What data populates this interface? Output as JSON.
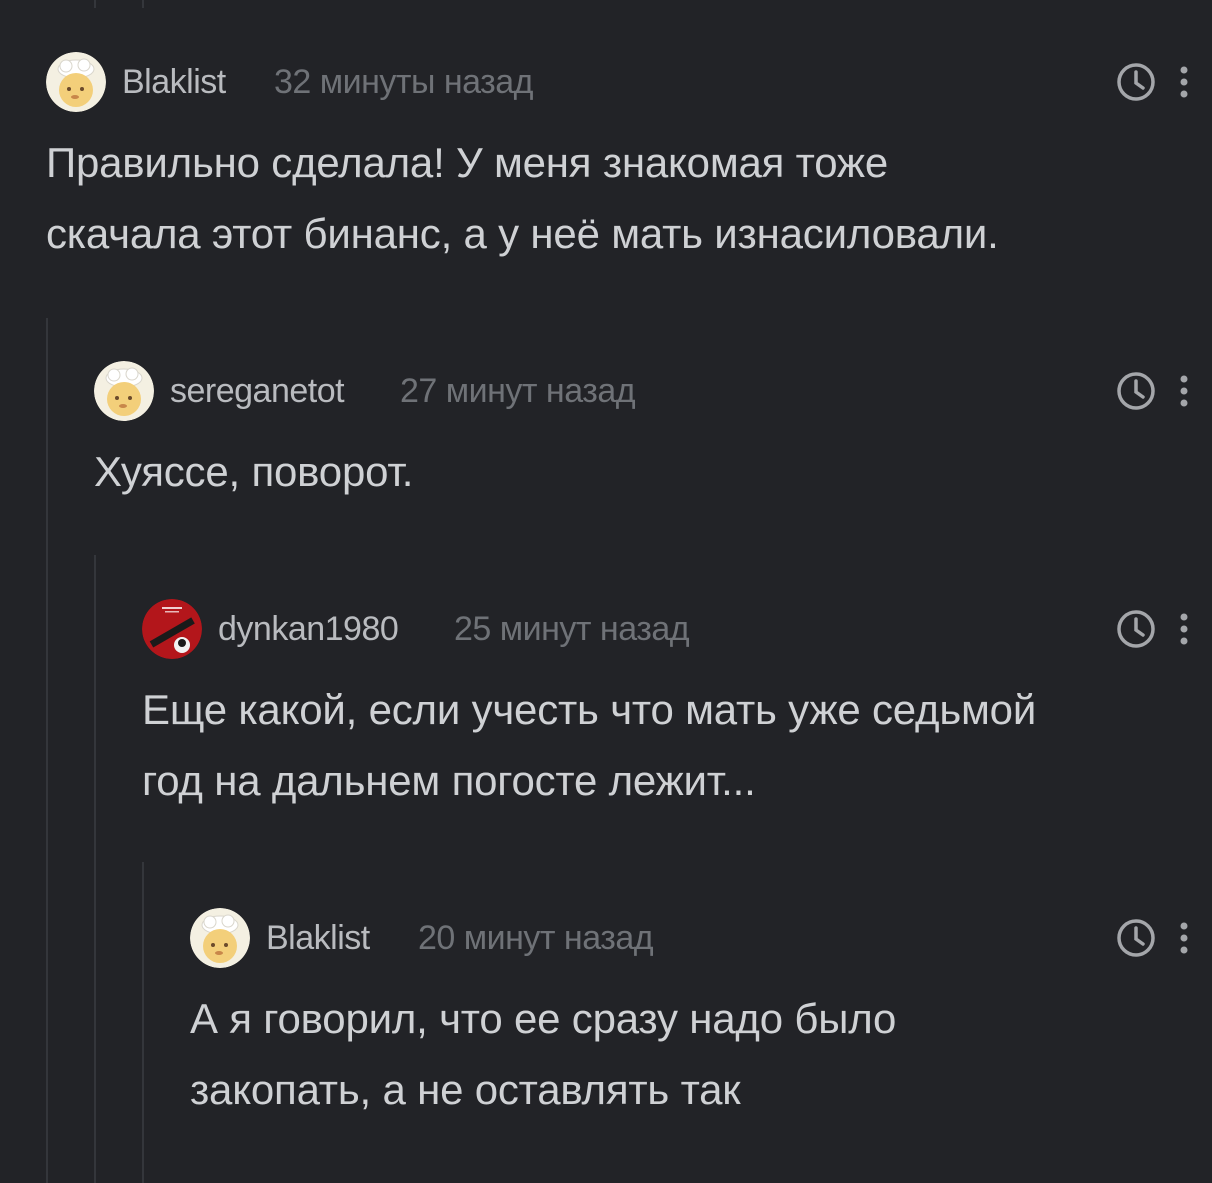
{
  "comments": [
    {
      "username": "Blaklist",
      "time": "32 минуты назад",
      "text_lines": [
        "Правильно сделала! У меня знакомая тоже",
        "скачала этот бинанс, а у неё мать изнасиловали."
      ],
      "avatar_icon": "baby-chef-avatar"
    },
    {
      "username": "sereganetot",
      "time": "27 минут назад",
      "text_lines": [
        "Хуяссе, поворот."
      ],
      "avatar_icon": "baby-chef-avatar"
    },
    {
      "username": "dynkan1980",
      "time": "25 минут назад",
      "text_lines": [
        "Еще какой, если учесть что мать уже седьмой",
        "год на дальнем погосте лежит..."
      ],
      "avatar_icon": "red-poster-avatar"
    },
    {
      "username": "Blaklist",
      "time": "20 минут назад",
      "text_lines": [
        "А я говорил, что ее сразу надо было",
        "закопать, а не оставлять так"
      ],
      "avatar_icon": "baby-chef-avatar"
    }
  ],
  "colors": {
    "background": "#222327",
    "text": "#cfd1d4",
    "username": "#b9bbbf",
    "meta": "#6f7277",
    "thread_line": "#34363b"
  },
  "icons": [
    "clock-icon",
    "more-vertical-icon"
  ]
}
